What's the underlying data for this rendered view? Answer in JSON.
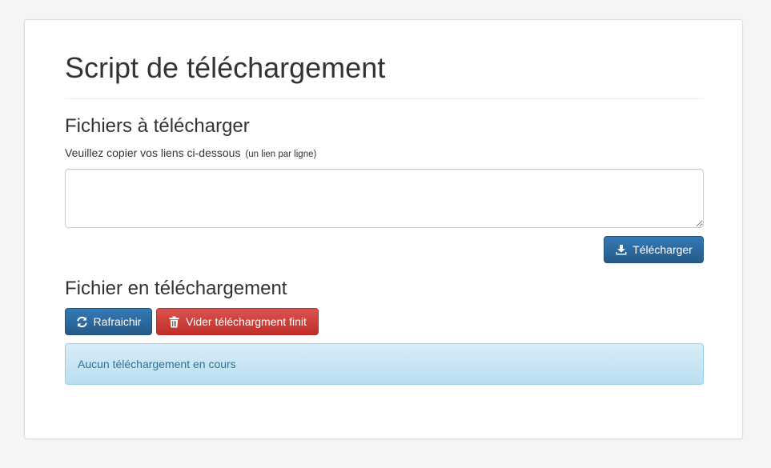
{
  "header": {
    "title": "Script de téléchargement"
  },
  "upload_section": {
    "title": "Fichiers à télécharger",
    "help_text": "Veuillez copier vos liens ci-dessous",
    "help_hint": "(un lien par ligne)",
    "links_value": "",
    "download_button": {
      "label": "Télécharger",
      "icon": "download-icon"
    }
  },
  "progress_section": {
    "title": "Fichier en téléchargement",
    "refresh_button": {
      "label": "Rafraichir",
      "icon": "refresh-icon"
    },
    "clear_button": {
      "label": "Vider téléchargment finit",
      "icon": "trash-icon"
    },
    "status_message": "Aucun téléchargement en cours"
  },
  "colors": {
    "primary": "#337ab7",
    "danger": "#d9534f",
    "info_background": "#d9edf7",
    "info_text": "#31708f"
  }
}
